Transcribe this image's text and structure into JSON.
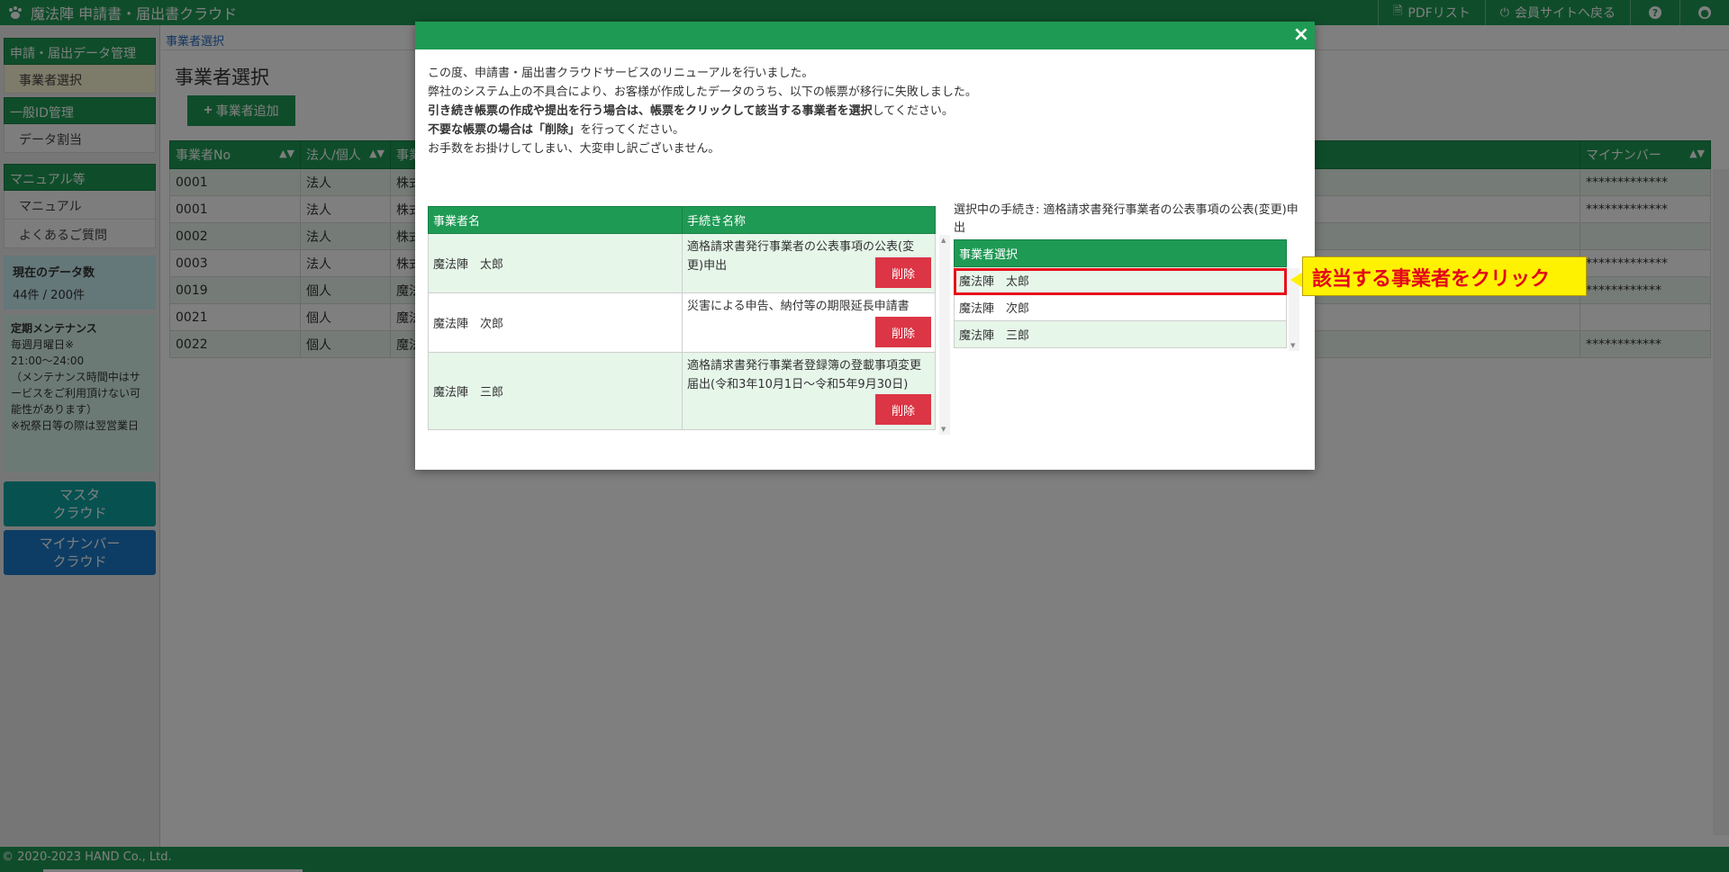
{
  "app": {
    "title": "魔法陣 申請書・届出書クラウド",
    "nav": {
      "pdf_list": "PDFリスト",
      "back_to_member": "会員サイトへ戻る",
      "help": "?"
    }
  },
  "sidebar": {
    "section1": {
      "title": "申請・届出データ管理",
      "items": [
        "事業者選択"
      ]
    },
    "section2": {
      "title": "一般ID管理",
      "items": [
        "データ割当"
      ]
    },
    "section3": {
      "title": "マニュアル等",
      "items": [
        "マニュアル",
        "よくあるご質問"
      ]
    },
    "data_count": {
      "title": "現在のデータ数",
      "value": "44件 / 200件"
    },
    "maintenance": {
      "title": "定期メンテナンス",
      "lines": [
        "毎週月曜日※",
        "21:00〜24:00",
        "（メンテナンス時間中はサービスをご利用頂けない可能性があります）",
        "※祝祭日等の際は翌営業日"
      ]
    },
    "btn_master": [
      "マスタ",
      "クラウド"
    ],
    "btn_mynumber": [
      "マイナンバー",
      "クラウド"
    ]
  },
  "main": {
    "breadcrumb": "事業者選択",
    "title": "事業者選択",
    "add_button": "事業者追加",
    "table": {
      "headers": [
        "事業者No",
        "法人/個人",
        "事業",
        "マイナンバー"
      ],
      "rows": [
        [
          "0001",
          "法人",
          "株式",
          "*************"
        ],
        [
          "0001",
          "法人",
          "株式",
          "*************"
        ],
        [
          "0002",
          "法人",
          "株式",
          ""
        ],
        [
          "0003",
          "法人",
          "株式",
          "*************"
        ],
        [
          "0019",
          "個人",
          "魔法",
          "************"
        ],
        [
          "0021",
          "個人",
          "魔法",
          ""
        ],
        [
          "0022",
          "個人",
          "魔法",
          "************"
        ]
      ]
    }
  },
  "footer": {
    "copyright": "© 2020-2023 HAND Co., Ltd."
  },
  "modal": {
    "close": "×",
    "notice": {
      "line1": "この度、申請書・届出書クラウドサービスのリニューアルを行いました。",
      "line2": "弊社のシステム上の不具合により、お客様が作成したデータのうち、以下の帳票が移行に失敗しました。",
      "line3_bold": "引き続き帳票の作成や提出を行う場合は、帳票をクリックして該当する事業者を選択",
      "line3_tail": "してください。",
      "line4_bold": "不要な帳票の場合は「削除」",
      "line4_tail": "を行ってください。",
      "line5": "お手数をお掛けしてしまい、大変申し訳ございません。"
    },
    "left_table": {
      "headers": [
        "事業者名",
        "手続き名称"
      ],
      "delete_label": "削除",
      "rows": [
        {
          "name": "魔法陣　太郎",
          "procedure": "適格請求書発行事業者の公表事項の公表(変更)申出"
        },
        {
          "name": "魔法陣　次郎",
          "procedure": "災害による申告、納付等の期限延長申請書"
        },
        {
          "name": "魔法陣　三郎",
          "procedure": "適格請求書発行事業者登録簿の登載事項変更届出(令和3年10月1日〜令和5年9月30日)"
        }
      ]
    },
    "selected_procedure": "選択中の手続き: 適格請求書発行事業者の公表事項の公表(変更)申出",
    "right_table": {
      "header": "事業者選択",
      "rows": [
        "魔法陣　太郎",
        "魔法陣　次郎",
        "魔法陣　三郎"
      ]
    },
    "callout": "該当する事業者をクリック"
  },
  "colors": {
    "brand_green": "#1f9a55",
    "delete_red": "#dc3545",
    "highlight_red": "#e8101a",
    "callout_yellow": "#fff200"
  }
}
